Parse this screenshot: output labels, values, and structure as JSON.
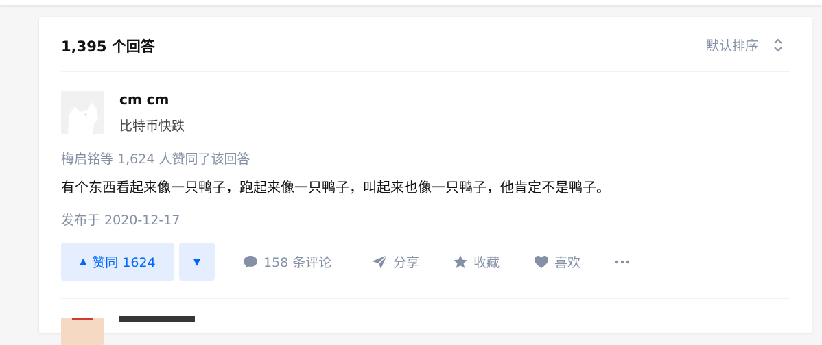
{
  "answers_header": {
    "count_label": "1,395 个回答",
    "sort_label": "默认排序",
    "sort_icon": "sort-icon"
  },
  "answer": {
    "author_name": "cm cm",
    "author_bio": "比特币快跌",
    "voters_text": "梅启铭等 1,624 人赞同了该回答",
    "content": "有个东西看起来像一只鸭子，跑起来像一只鸭子，叫起来也像一只鸭子，他肯定不是鸭子。",
    "published": "发布于 2020-12-17",
    "actions": {
      "upvote_label": "赞同 1624",
      "downvote_icon": "downvote-icon",
      "comments_label": "158 条评论",
      "share_label": "分享",
      "favorite_label": "收藏",
      "like_label": "喜欢",
      "more_icon": "more-icon"
    }
  },
  "colors": {
    "accent": "#0066ff",
    "accent_bg": "#e5eefe",
    "muted": "#8590a6",
    "text": "#121212"
  }
}
